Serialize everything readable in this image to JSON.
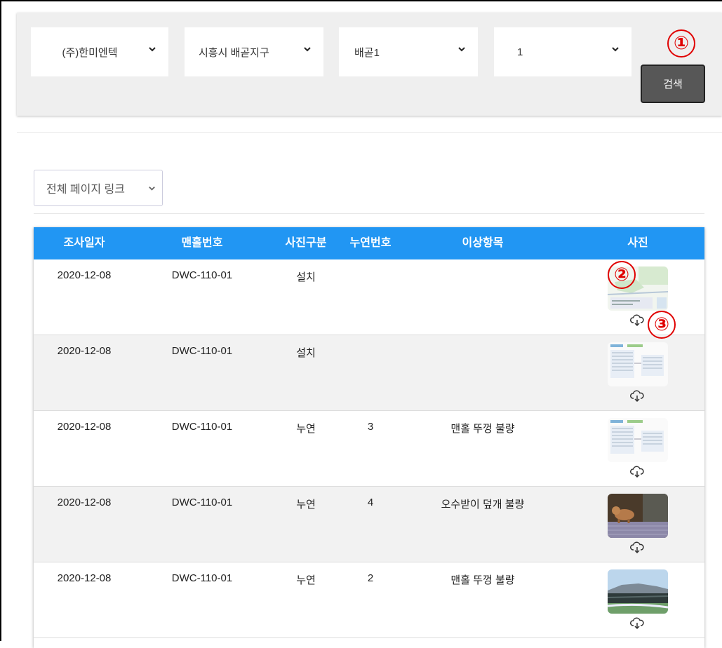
{
  "filters": {
    "company": "(주)한미엔텍",
    "district": "시흥시 배곧지구",
    "area": "배곧1",
    "number": "1",
    "search_label": "검색"
  },
  "page_link": {
    "label": "전체 페이지 링크"
  },
  "table": {
    "headers": [
      "조사일자",
      "맨홀번호",
      "사진구분",
      "누연번호",
      "이상항목",
      "사진"
    ],
    "rows": [
      {
        "date": "2020-12-08",
        "manhole": "DWC-110-01",
        "type": "설치",
        "leak_no": "",
        "issue": "",
        "photo": "map-photo"
      },
      {
        "date": "2020-12-08",
        "manhole": "DWC-110-01",
        "type": "설치",
        "leak_no": "",
        "issue": "",
        "photo": "document-photo"
      },
      {
        "date": "2020-12-08",
        "manhole": "DWC-110-01",
        "type": "누연",
        "leak_no": "3",
        "issue": "맨홀 뚜껑 불량",
        "photo": "document-photo"
      },
      {
        "date": "2020-12-08",
        "manhole": "DWC-110-01",
        "type": "누연",
        "leak_no": "4",
        "issue": "오수받이 덮개 불량",
        "photo": "dog-photo"
      },
      {
        "date": "2020-12-08",
        "manhole": "DWC-110-01",
        "type": "누연",
        "leak_no": "2",
        "issue": "맨홀 뚜껑 불량",
        "photo": "landscape-photo"
      }
    ]
  },
  "markers": [
    "①",
    "②",
    "③"
  ],
  "colors": {
    "header": "#2196f3",
    "search_button": "#575757",
    "marker": "#e00000"
  },
  "icons": {
    "dropdown": "chevron-down-icon",
    "download": "cloud-download-icon"
  }
}
